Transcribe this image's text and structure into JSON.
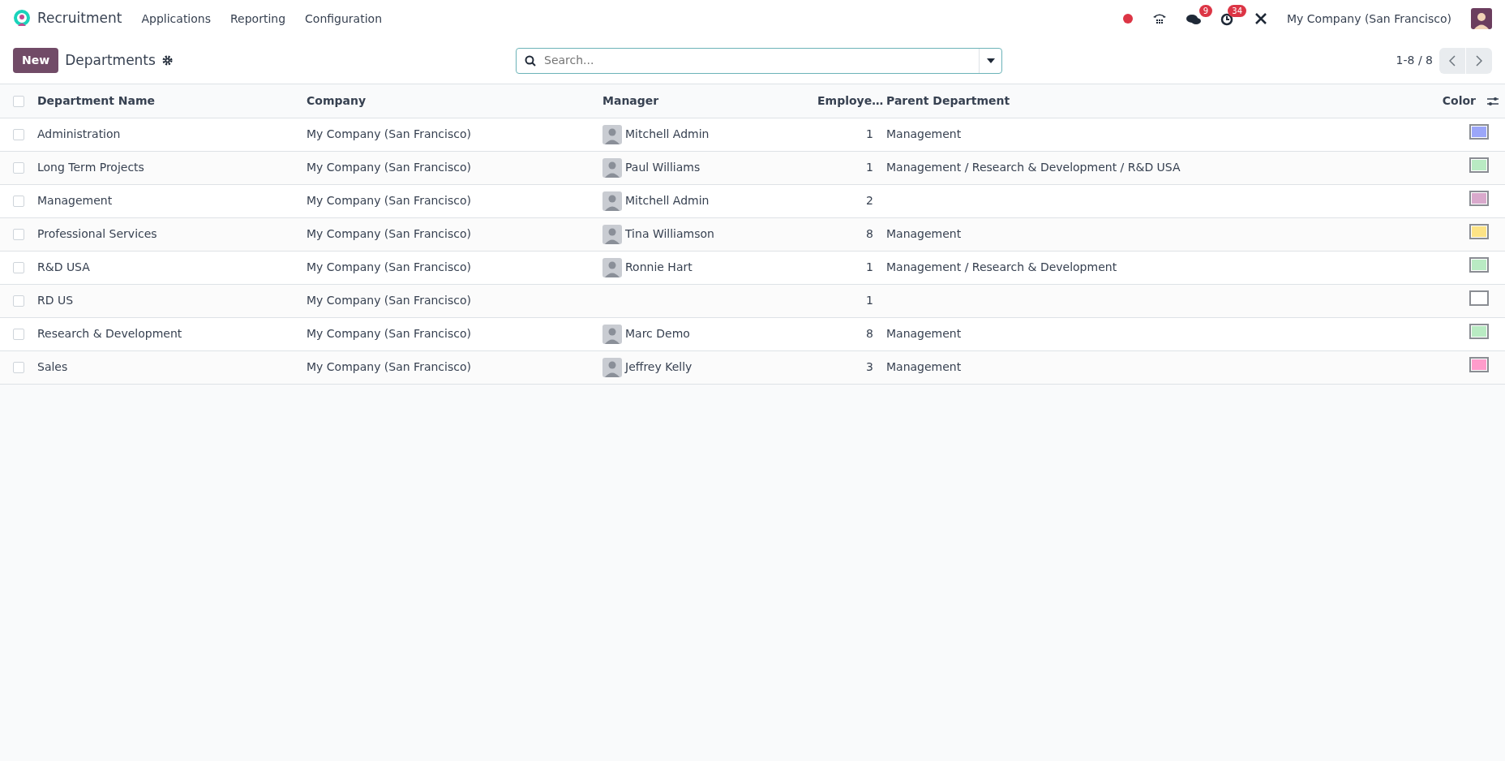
{
  "navbar": {
    "app_name": "Recruitment",
    "menu": [
      "Applications",
      "Reporting",
      "Configuration"
    ],
    "messages_badge": "9",
    "activities_badge": "34",
    "company": "My Company (San Francisco)"
  },
  "control_panel": {
    "new_button": "New",
    "title": "Departments",
    "search": {
      "placeholder": "Search..."
    },
    "pager": "1-8 / 8"
  },
  "table": {
    "select_all_checked": false,
    "columns": [
      "Department Name",
      "Company",
      "Manager",
      "Employe…",
      "Parent Department",
      "Color"
    ],
    "rows": [
      {
        "checked": false,
        "name": "Administration",
        "company": "My Company (San Francisco)",
        "manager": "Mitchell Admin",
        "employees": "1",
        "parent": "Management",
        "color": "#9ba6f8"
      },
      {
        "checked": false,
        "name": "Long Term Projects",
        "company": "My Company (San Francisco)",
        "manager": "Paul Williams",
        "employees": "1",
        "parent": "Management / Research & Development / R&D USA",
        "color": "#b9ebc3"
      },
      {
        "checked": false,
        "name": "Management",
        "company": "My Company (San Francisco)",
        "manager": "Mitchell Admin",
        "employees": "2",
        "color": "#d9a9cc"
      },
      {
        "checked": false,
        "name": "Professional Services",
        "company": "My Company (San Francisco)",
        "manager": "Tina Williamson",
        "employees": "8",
        "parent": "Management",
        "color": "#fde386"
      },
      {
        "checked": false,
        "name": "R&D USA",
        "company": "My Company (San Francisco)",
        "manager": "Ronnie Hart",
        "employees": "1",
        "parent": "Management / Research & Development",
        "color": "#b9ebc3"
      },
      {
        "checked": false,
        "name": "RD US",
        "company": "My Company (San Francisco)",
        "employees": "1",
        "color": "#ffffff"
      },
      {
        "checked": false,
        "name": "Research & Development",
        "company": "My Company (San Francisco)",
        "manager": "Marc Demo",
        "employees": "8",
        "parent": "Management",
        "color": "#b9ebc3"
      },
      {
        "checked": false,
        "name": "Sales",
        "company": "My Company (San Francisco)",
        "manager": "Jeffrey Kelly",
        "employees": "3",
        "parent": "Management",
        "color": "#ff9ccb"
      }
    ]
  }
}
